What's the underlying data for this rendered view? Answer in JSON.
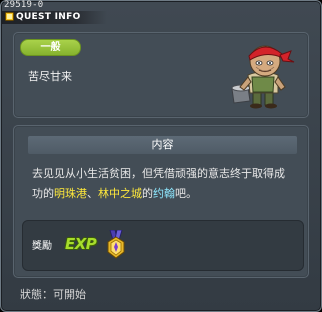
{
  "window": {
    "quest_id": "29519-0",
    "title": "QUEST INFO"
  },
  "header": {
    "category_tag": "一般",
    "quest_name": "苦尽甘来",
    "npc_portrait": "npc-bandana-man-icon"
  },
  "details": {
    "section_title": "内容",
    "description": {
      "part1": "去见见从小生活贫困，但凭借顽强的意志终于取得成功的",
      "place1": "明珠港",
      "sep": "、",
      "place2": "林中之城",
      "mid": "的",
      "npc": "约翰",
      "end": "吧。"
    },
    "reward": {
      "label": "獎勵",
      "items": [
        "exp-icon",
        "medal-icon"
      ],
      "exp_text": "EXP"
    }
  },
  "footer": {
    "status_label": "狀態：",
    "status_value": "可開始"
  },
  "colors": {
    "highlight_place": "#ffe93b",
    "highlight_npc": "#8ee8ff",
    "tag_green": "#9ac63d"
  }
}
